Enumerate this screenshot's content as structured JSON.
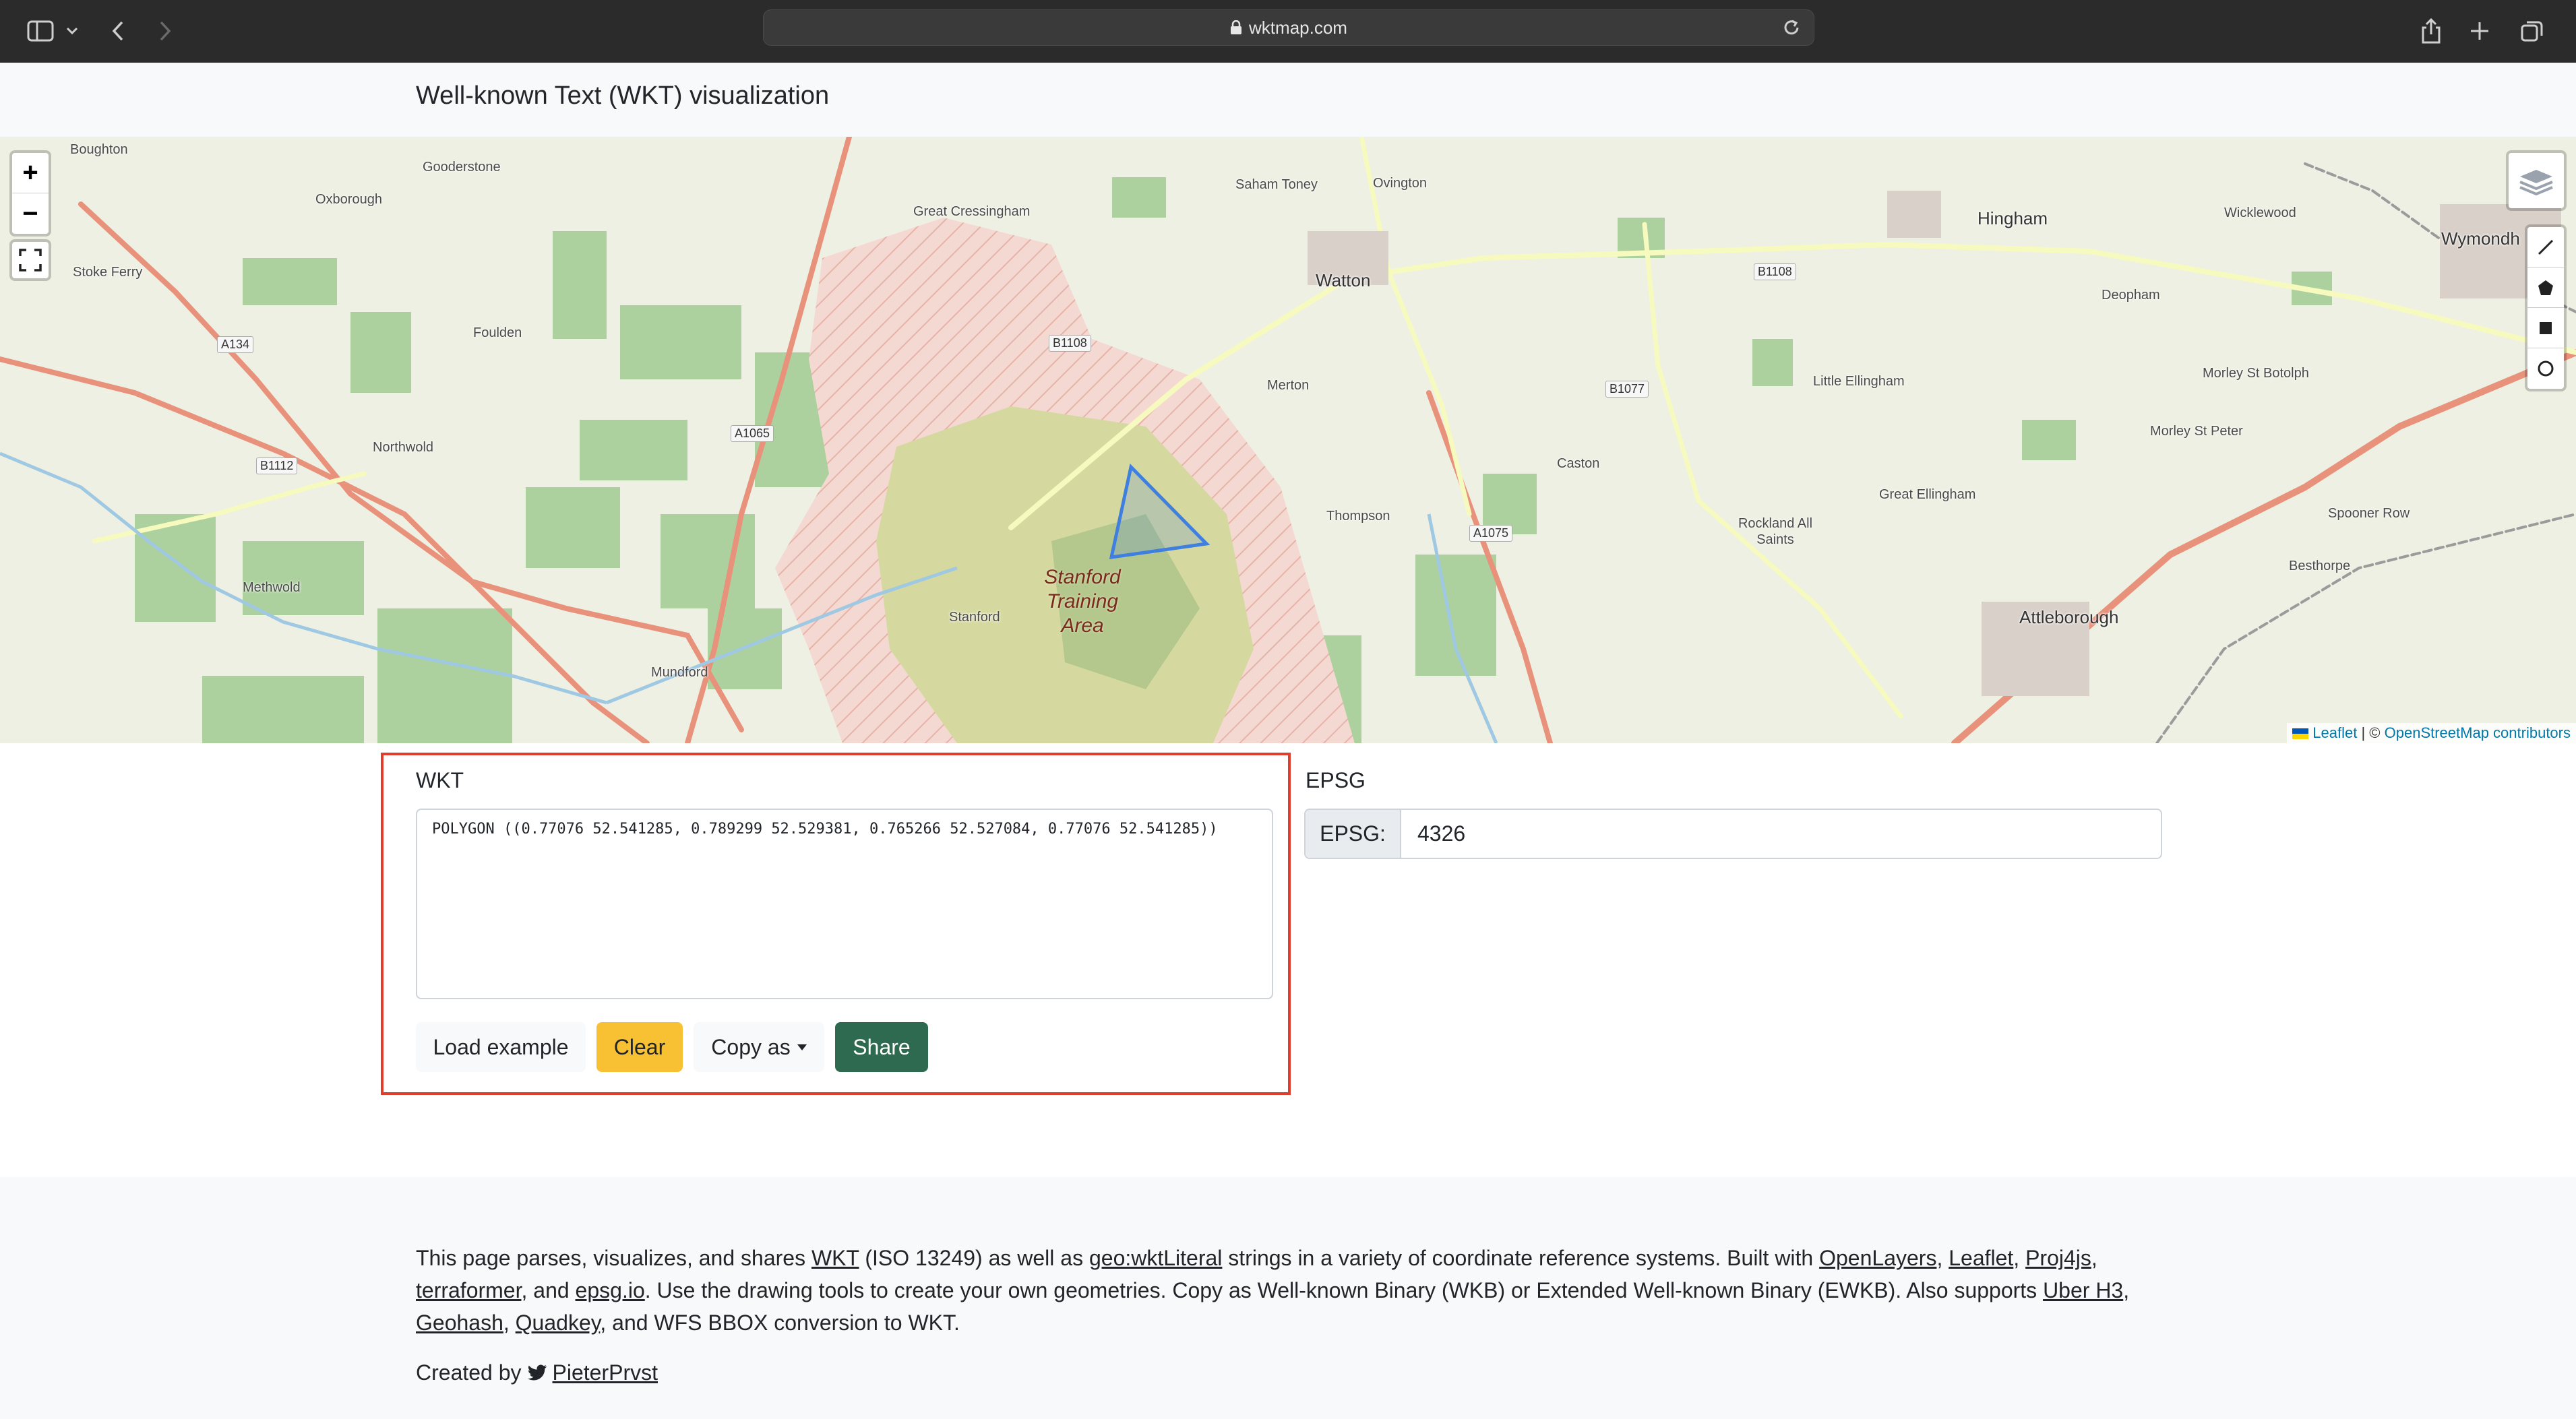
{
  "browser": {
    "url": "wktmap.com"
  },
  "header": {
    "title": "Well-known Text (WKT) visualization"
  },
  "map": {
    "places": [
      {
        "name": "Boughton",
        "kind": "village"
      },
      {
        "name": "Gooderstone",
        "kind": "village"
      },
      {
        "name": "Oxborough",
        "kind": "village"
      },
      {
        "name": "Great Cressingham",
        "kind": "village"
      },
      {
        "name": "Saham Toney",
        "kind": "village"
      },
      {
        "name": "Ovington",
        "kind": "village"
      },
      {
        "name": "Hingham",
        "kind": "town"
      },
      {
        "name": "Wicklewood",
        "kind": "village"
      },
      {
        "name": "Wymondh",
        "kind": "town"
      },
      {
        "name": "Stoke Ferry",
        "kind": "village"
      },
      {
        "name": "Foulden",
        "kind": "village"
      },
      {
        "name": "Watton",
        "kind": "town"
      },
      {
        "name": "Deopham",
        "kind": "village"
      },
      {
        "name": "Merton",
        "kind": "village"
      },
      {
        "name": "Little Ellingham",
        "kind": "village"
      },
      {
        "name": "Morley St Botolph",
        "kind": "village"
      },
      {
        "name": "Northwold",
        "kind": "village"
      },
      {
        "name": "Caston",
        "kind": "village"
      },
      {
        "name": "Morley St Peter",
        "kind": "village"
      },
      {
        "name": "Great Ellingham",
        "kind": "village"
      },
      {
        "name": "Thompson",
        "kind": "village"
      },
      {
        "name": "Rockland All Saints",
        "kind": "village"
      },
      {
        "name": "Spooner Row",
        "kind": "village"
      },
      {
        "name": "Methwold",
        "kind": "village"
      },
      {
        "name": "Besthorpe",
        "kind": "village"
      },
      {
        "name": "Stanford",
        "kind": "village"
      },
      {
        "name": "Attleborough",
        "kind": "town"
      },
      {
        "name": "Mundford",
        "kind": "village"
      }
    ],
    "roads": [
      "A134",
      "B1108",
      "B1108",
      "A1065",
      "B1077",
      "B1112",
      "A1075"
    ],
    "area_label": [
      "Stanford",
      "Training",
      "Area"
    ],
    "controls": {
      "zoom_in": "+",
      "zoom_out": "−"
    },
    "attribution": {
      "leaflet": "Leaflet",
      "separator": " | © ",
      "osm": "OpenStreetMap contributors"
    },
    "polygon_color": "#3f7fe0"
  },
  "wkt": {
    "label": "WKT",
    "value": "POLYGON ((0.77076 52.541285, 0.789299 52.529381, 0.765266 52.527084, 0.77076 52.541285))",
    "buttons": {
      "load_example": "Load example",
      "clear": "Clear",
      "copy_as": "Copy as",
      "share": "Share"
    },
    "highlight_color": "#e03e2d"
  },
  "epsg": {
    "label": "EPSG",
    "addon": "EPSG:",
    "value": "4326"
  },
  "footer": {
    "t1": "This page parses, visualizes, and shares ",
    "l_wkt": "WKT",
    "t2": " (ISO 13249) as well as ",
    "l_geo": "geo:wktLiteral",
    "t3": " strings in a variety of coordinate reference systems. Built with ",
    "l_ol": "OpenLayers",
    "t4": ", ",
    "l_leaflet": "Leaflet",
    "t5": ", ",
    "l_proj": "Proj4js",
    "t6": ", ",
    "l_terra": "terraformer",
    "t7": ", and ",
    "l_epsgio": "epsg.io",
    "t8": ". Use the drawing tools to create your own geometries. Copy as Well-known Binary (WKB) or Extended Well-known Binary (EWKB). Also supports ",
    "l_h3": "Uber H3",
    "t9": ", ",
    "l_geohash": "Geohash",
    "t10": ", ",
    "l_quadkey": "Quadkey",
    "t11": ", and WFS BBOX conversion to WKT.",
    "created_by": "Created by",
    "author": "PieterPrvst"
  }
}
